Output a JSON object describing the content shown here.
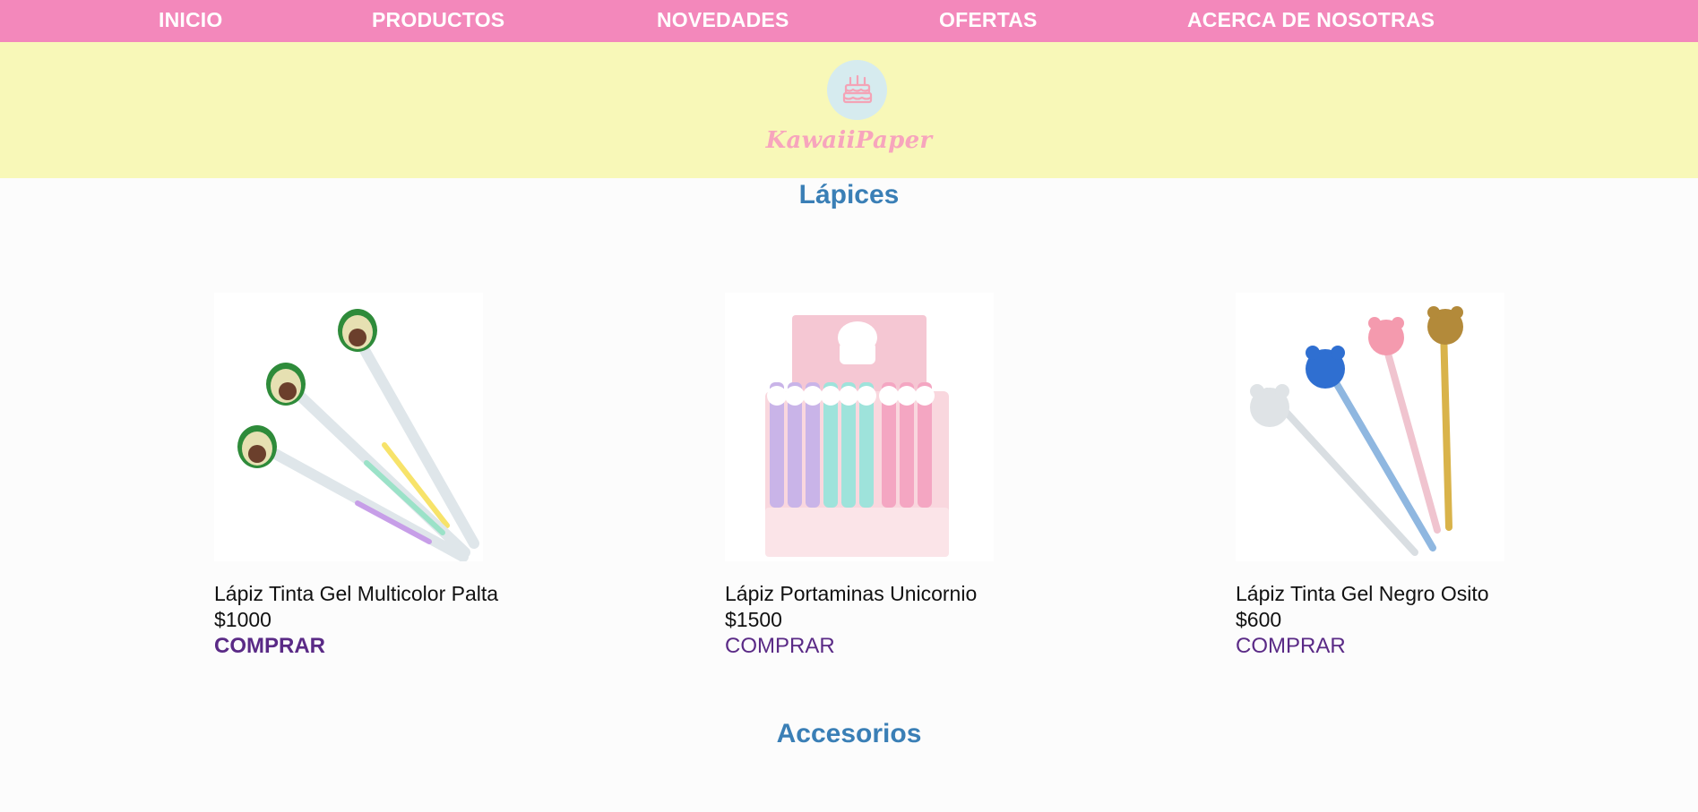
{
  "nav": {
    "items": [
      {
        "label": "INICIO"
      },
      {
        "label": "PRODUCTOS"
      },
      {
        "label": "NOVEDADES"
      },
      {
        "label": "OFERTAS"
      },
      {
        "label": "ACERCA DE NOSOTRAS"
      }
    ]
  },
  "header": {
    "brand": "KawaiiPaper",
    "logo_icon": "cake-icon"
  },
  "sections": [
    {
      "title": "Lápices",
      "products": [
        {
          "name": "Lápiz Tinta Gel Multicolor Palta",
          "price": "$1000",
          "buy_label": "COMPRAR",
          "image": "avocado-gel-pens"
        },
        {
          "name": "Lápiz Portaminas Unicornio",
          "price": "$1500",
          "buy_label": "COMPRAR",
          "image": "unicorn-mechanical-pencils"
        },
        {
          "name": "Lápiz Tinta Gel Negro Osito",
          "price": "$600",
          "buy_label": "COMPRAR",
          "image": "bear-gel-pens"
        }
      ]
    },
    {
      "title": "Accesorios"
    }
  ],
  "colors": {
    "nav_bg": "#f388bb",
    "banner_bg": "#f8f8b8",
    "section_title": "#3a7fb6",
    "link": "#5a2a86",
    "brand": "#f7a5bd"
  }
}
